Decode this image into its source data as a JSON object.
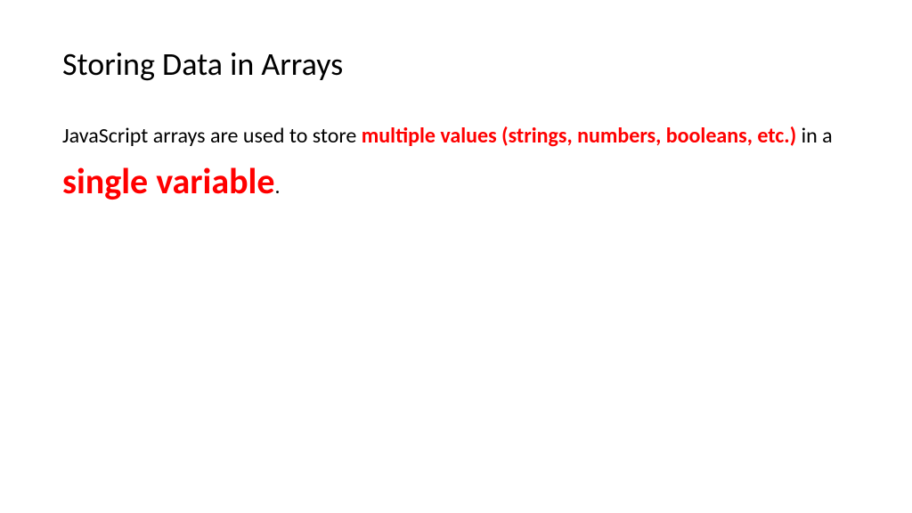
{
  "slide": {
    "title": "Storing Data in Arrays",
    "body": {
      "part1": "JavaScript arrays are used to store ",
      "highlight1": "multiple values (strings, numbers, booleans, etc.) ",
      "part2": "in a ",
      "highlight2": "single variable",
      "part3": "."
    }
  }
}
